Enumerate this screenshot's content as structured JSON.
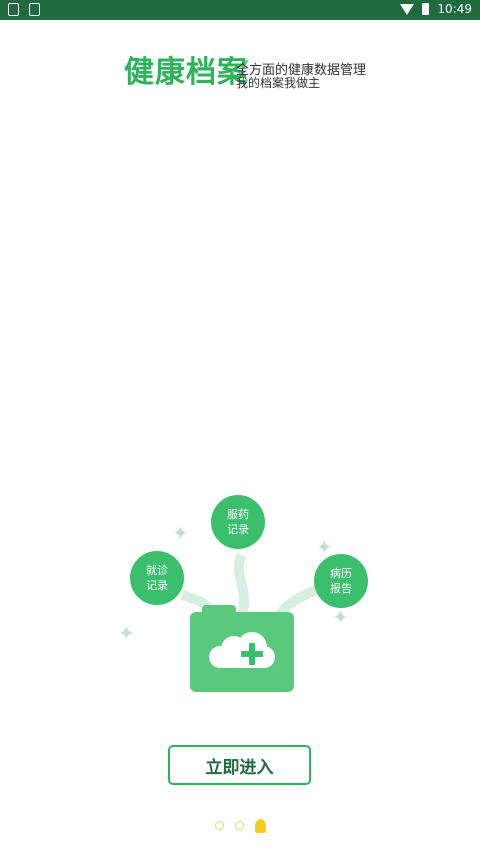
{
  "status_bar": {
    "time": "10:49",
    "icons": [
      "shield-icon",
      "image-icon",
      "wifi-icon",
      "battery-icon"
    ]
  },
  "header": {
    "title": "健康档案",
    "subtitle_line1": "全方面的健康数据管理",
    "subtitle_line2": "我的档案我做主"
  },
  "illustration": {
    "bubbles": {
      "medication": "服药\n记录",
      "consultation": "就诊\n记录",
      "report": "病历\n报告"
    },
    "folder_icon": "cloud-plus-icon"
  },
  "enter_button": {
    "label": "立即进入"
  },
  "page_indicator": {
    "total": 3,
    "current": 3
  },
  "colors": {
    "status_bar": "#1f6b3f",
    "accent": "#2fb35a",
    "bubble": "#3cbf6c",
    "indicator": "#f1cf1f"
  }
}
